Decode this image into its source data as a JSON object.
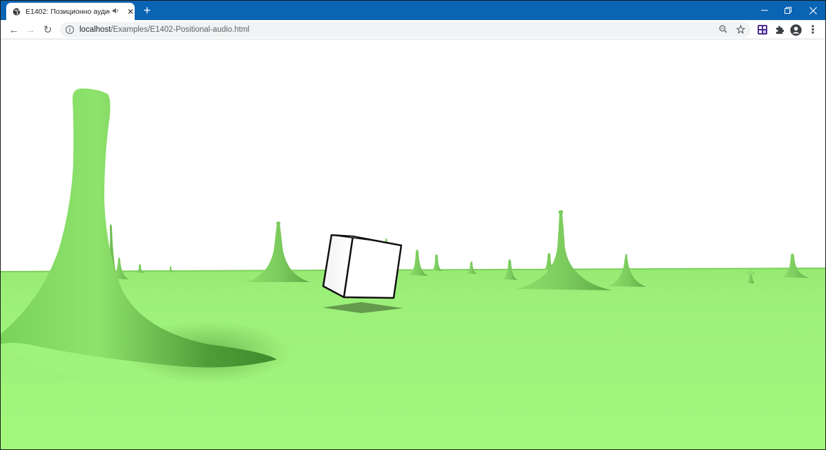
{
  "browser": {
    "tab": {
      "title": "E1402: Позиционно аудио",
      "audio_icon": "speaker-icon",
      "close_glyph": "✕"
    },
    "new_tab_glyph": "+",
    "window_controls": {
      "minimize": "—",
      "restore": "❐",
      "close": "✕"
    },
    "toolbar": {
      "back": "←",
      "forward": "→",
      "reload": "↻",
      "url_host": "localhost",
      "url_path": "/Examples/E1402-Positional-audio.html",
      "menu": "⋮"
    },
    "colors": {
      "tabstrip": "#0a64b4",
      "ground": "#a0f47a",
      "extension": "#4b2c8e"
    }
  },
  "scene": {
    "description_objects": [
      "ground-plane",
      "rotating-cube",
      "cube-shadow",
      "green-spikes"
    ]
  }
}
